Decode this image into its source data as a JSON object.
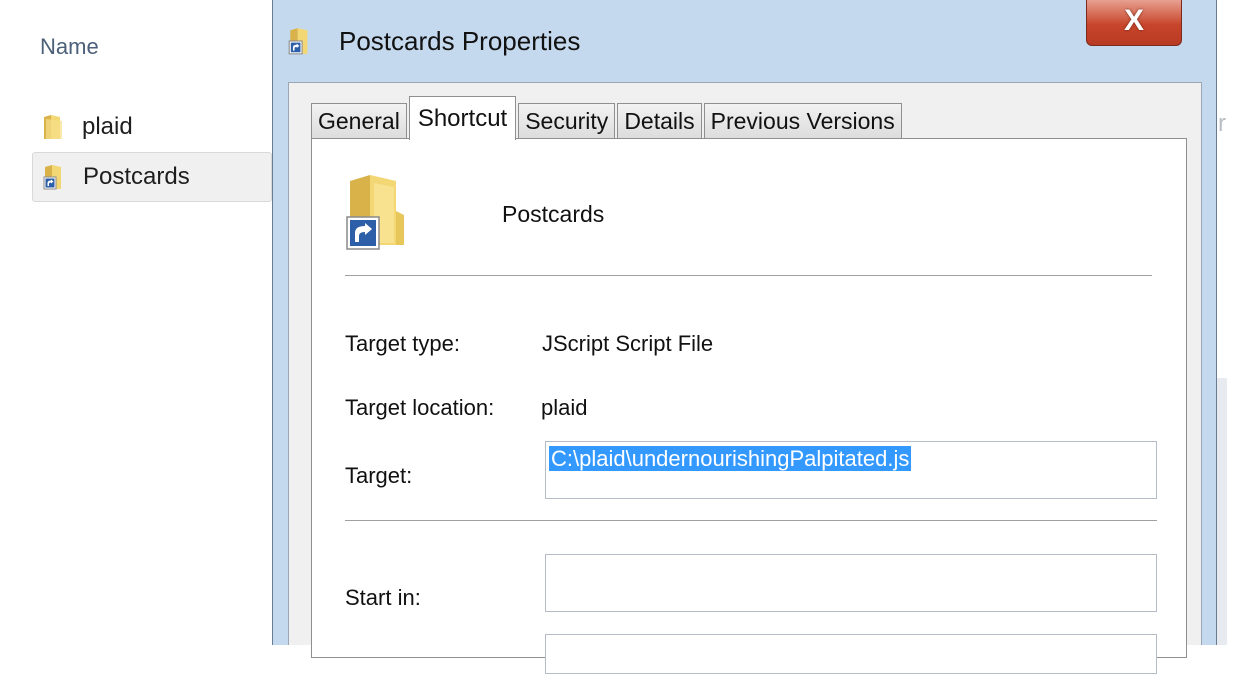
{
  "explorer": {
    "column_header": "Name",
    "files": [
      {
        "name": "plaid",
        "icon": "folder-icon",
        "selected": false
      },
      {
        "name": "Postcards",
        "icon": "folder-shortcut-icon",
        "selected": true
      }
    ],
    "partial_column_text": "r"
  },
  "dialog": {
    "title": "Postcards Properties",
    "close_glyph": "X",
    "tabs": [
      {
        "label": "General",
        "active": false
      },
      {
        "label": "Shortcut",
        "active": true
      },
      {
        "label": "Security",
        "active": false
      },
      {
        "label": "Details",
        "active": false
      },
      {
        "label": "Previous Versions",
        "active": false
      }
    ],
    "shortcut": {
      "name": "Postcards",
      "target_type_label": "Target type:",
      "target_type_value": "JScript Script File",
      "target_location_label": "Target location:",
      "target_location_value": "plaid",
      "target_label": "Target:",
      "target_value": "C:\\plaid\\undernourishingPalpitated.js",
      "start_in_label": "Start in:",
      "start_in_value": ""
    }
  },
  "colors": {
    "dialog_frame": "#c5d9ee",
    "close_button": "#c7452b",
    "selection": "#3399ff",
    "folder": "#f3d774"
  }
}
